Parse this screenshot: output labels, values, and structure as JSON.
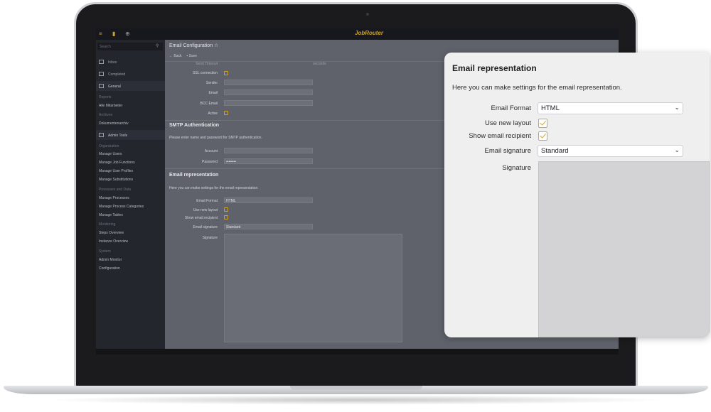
{
  "app": {
    "brand": "JobRouter",
    "breadcrumb": "Email Configuration",
    "toolbar": {
      "back": "Back",
      "save": "Save"
    }
  },
  "sidebar": {
    "search_placeholder": "Search",
    "sections": {
      "inbox": "Inbox",
      "completed": "Completed",
      "general": "General",
      "admin_tools": "Admin Tools"
    },
    "categories": {
      "reports": "Reports",
      "archives": "Archives",
      "organization": "Organization",
      "processes_and_data": "Processes and Data",
      "monitoring": "Monitoring",
      "system": "System"
    },
    "links": {
      "alle_mitarbeiter": "Alle Mitarbeiter",
      "dokumentenarchiv": "Dokumentenarchiv",
      "manage_users": "Manage Users",
      "manage_job_functions": "Manage Job Functions",
      "manage_user_profiles": "Manage User Profiles",
      "manage_substitutions": "Manage Substitutions",
      "manage_processes": "Manage Processes",
      "manage_process_categories": "Manage Process Categories",
      "manage_tables": "Manage Tables",
      "steps_overview": "Steps Overview",
      "instance_overview": "Instance Overview",
      "admin_monitor": "Admin Monitor",
      "configuration": "Configuration"
    }
  },
  "main": {
    "partial_top_label": "Send Timeout",
    "partial_top_unit": "seconds",
    "smtp_fields": {
      "ssl": "SSL connection",
      "sender": "Sender",
      "email": "Email",
      "bcc": "BCC Email",
      "active": "Active"
    },
    "smtp_auth": {
      "title": "SMTP Authentication",
      "desc": "Please enter name and password for SMTP authentication.",
      "account": "Account",
      "password_label": "Password",
      "password_value": "••••••••"
    },
    "email_rep": {
      "title": "Email representation",
      "desc": "Here you can make settings for the email representation.",
      "format_label": "Email Format",
      "format_value": "HTML",
      "layout_label": "Use new layout",
      "recipient_label": "Show email recipient",
      "signature_label": "Email signature",
      "signature_value": "Standard",
      "signature_text_label": "Signature"
    }
  },
  "dialog": {
    "title": "Email representation",
    "description": "Here you can make settings for the email representation.",
    "email_format_label": "Email Format",
    "email_format_value": "HTML",
    "use_new_layout_label": "Use new layout",
    "use_new_layout_checked": true,
    "show_recipient_label": "Show email recipient",
    "show_recipient_checked": true,
    "email_signature_label": "Email signature",
    "email_signature_value": "Standard",
    "signature_label": "Signature"
  },
  "colors": {
    "accent": "#d9a91f",
    "sidebar": "#24262d",
    "dialog_bg": "#efefef"
  },
  "icons": [
    "menu-icon",
    "bookmark-icon",
    "add-icon",
    "search-icon",
    "inbox-icon",
    "completed-icon",
    "general-icon",
    "wrench-icon",
    "back-arrow-icon",
    "save-icon",
    "star-icon",
    "chevron-down-icon",
    "checkmark-icon"
  ]
}
